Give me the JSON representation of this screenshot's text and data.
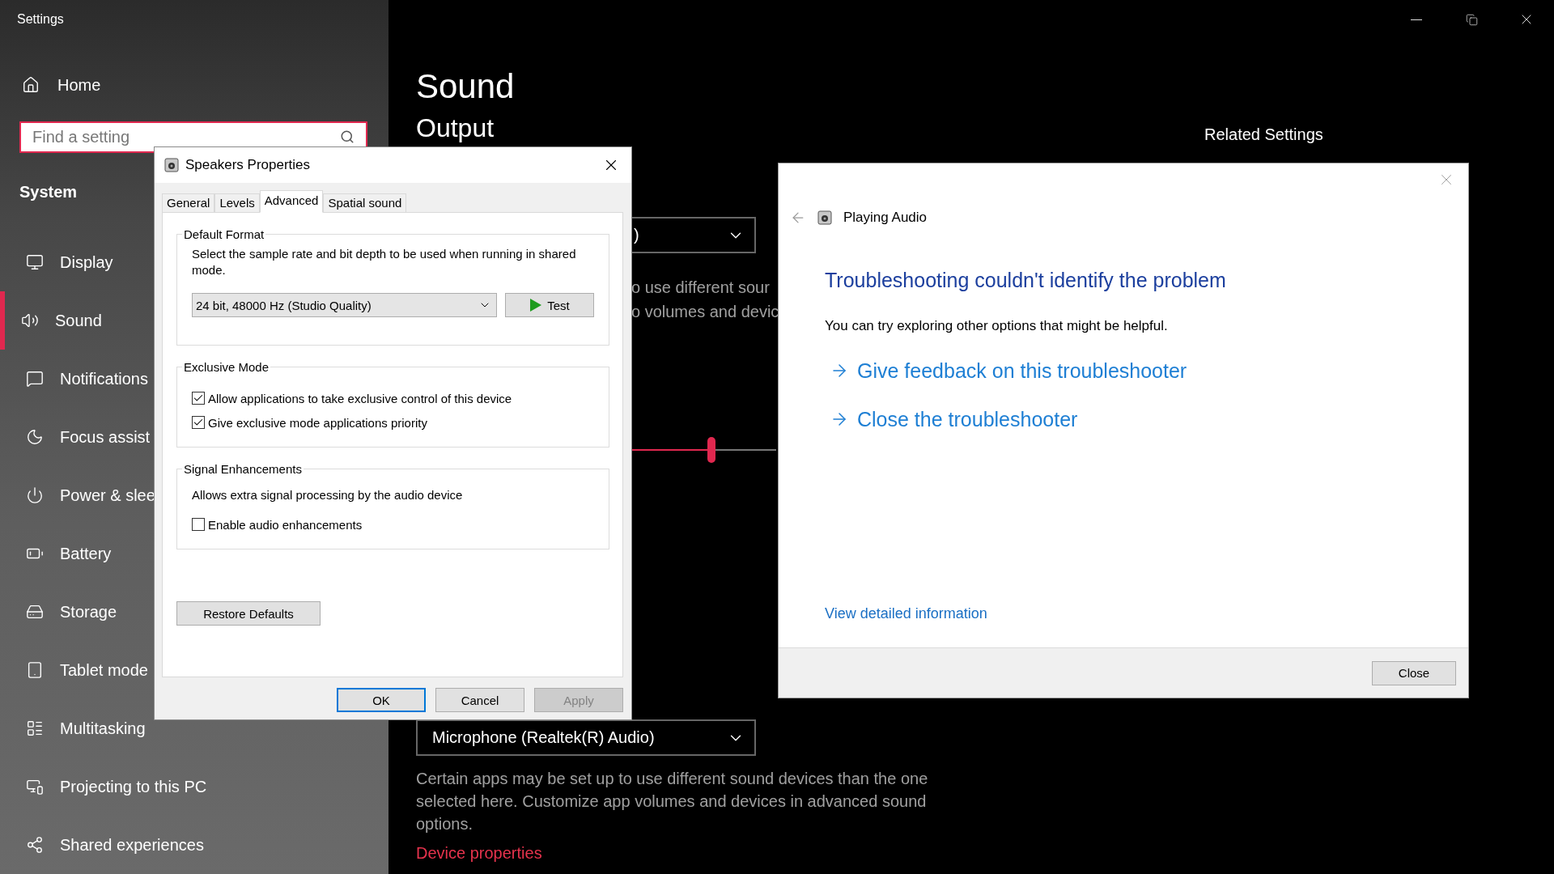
{
  "settings_window": {
    "title": "Settings"
  },
  "sidebar": {
    "home": "Home",
    "search": {
      "placeholder": "Find a setting"
    },
    "section": "System",
    "items": [
      {
        "label": "Display",
        "selected": false
      },
      {
        "label": "Sound",
        "selected": true
      },
      {
        "label": "Notifications",
        "selected": false
      },
      {
        "label": "Focus assist",
        "selected": false
      },
      {
        "label": "Power & slee",
        "selected": false
      },
      {
        "label": "Battery",
        "selected": false
      },
      {
        "label": "Storage",
        "selected": false
      },
      {
        "label": "Tablet mode",
        "selected": false
      },
      {
        "label": "Multitasking",
        "selected": false
      },
      {
        "label": "Projecting to this PC",
        "selected": false
      },
      {
        "label": "Shared experiences",
        "selected": false
      }
    ]
  },
  "main": {
    "title": "Sound",
    "output_heading": "Output",
    "output_device": ")",
    "output_note_lines": [
      "o use different sour",
      "o volumes and devic"
    ],
    "volume": {
      "level": 0.82
    },
    "input_device": "Microphone (Realtek(R) Audio)",
    "input_note": "Certain apps may be set up to use different sound devices than the one selected here. Customize app volumes and devices in advanced sound options.",
    "device_properties": "Device properties",
    "related_settings": "Related Settings"
  },
  "speakers_dialog": {
    "title": "Speakers Properties",
    "tabs": [
      {
        "label": "General",
        "selected": false
      },
      {
        "label": "Levels",
        "selected": false
      },
      {
        "label": "Advanced",
        "selected": true
      },
      {
        "label": "Spatial sound",
        "selected": false
      }
    ],
    "default_format": {
      "legend": "Default Format",
      "description": "Select the sample rate and bit depth to be used when running in shared mode.",
      "format": "24 bit, 48000 Hz (Studio Quality)",
      "test": "Test"
    },
    "exclusive_mode": {
      "legend": "Exclusive Mode",
      "options": [
        {
          "label": "Allow applications to take exclusive control of this device",
          "checked": true
        },
        {
          "label": "Give exclusive mode applications priority",
          "checked": true
        }
      ]
    },
    "signal_enhancements": {
      "legend": "Signal Enhancements",
      "description": "Allows extra signal processing by the audio device",
      "options": [
        {
          "label": "Enable audio enhancements",
          "checked": false
        }
      ]
    },
    "restore": "Restore Defaults",
    "buttons": [
      {
        "label": "OK",
        "disabled": false,
        "default": true
      },
      {
        "label": "Cancel",
        "disabled": false,
        "default": false
      },
      {
        "label": "Apply",
        "disabled": true,
        "default": false
      }
    ]
  },
  "troubleshooter": {
    "title": "Playing Audio",
    "heading": "Troubleshooting couldn't identify the problem",
    "message": "You can try exploring other options that might be helpful.",
    "links": [
      "Give feedback on this troubleshooter",
      "Close the troubleshooter"
    ],
    "details": "View detailed information",
    "close": "Close"
  }
}
